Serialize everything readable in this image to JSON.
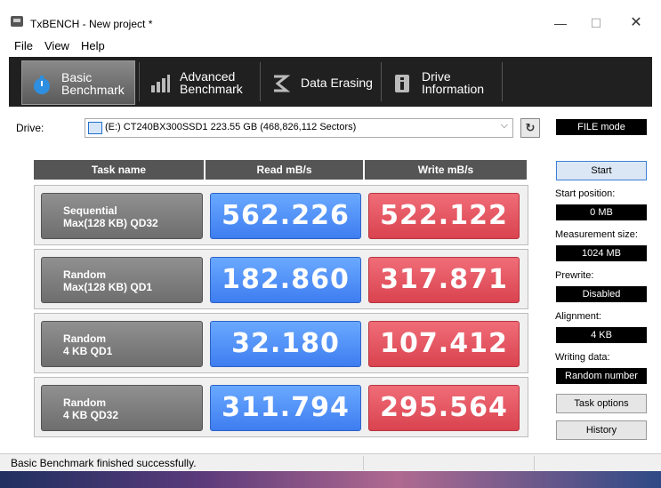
{
  "window": {
    "title": "TxBENCH - New project *",
    "min": "—",
    "max": "☐",
    "close": "✕"
  },
  "menu": [
    "File",
    "View",
    "Help"
  ],
  "tabs": [
    {
      "label1": "Basic",
      "label2": "Benchmark"
    },
    {
      "label1": "Advanced",
      "label2": "Benchmark"
    },
    {
      "label1": "Data Erasing",
      "label2": ""
    },
    {
      "label1": "Drive",
      "label2": "Information"
    }
  ],
  "drive": {
    "label": "Drive:",
    "selected": "(E:) CT240BX300SSD1  223.55 GB (468,826,112 Sectors)",
    "refresh_glyph": "↻"
  },
  "table": {
    "headers": [
      "Task name",
      "Read mB/s",
      "Write mB/s"
    ],
    "rows": [
      {
        "name1": "Sequential",
        "name2": "Max(128 KB) QD32",
        "read": "562.226",
        "write": "522.122"
      },
      {
        "name1": "Random",
        "name2": "Max(128 KB) QD1",
        "read": "182.860",
        "write": "317.871"
      },
      {
        "name1": "Random",
        "name2": "4 KB QD1",
        "read": "32.180",
        "write": "107.412"
      },
      {
        "name1": "Random",
        "name2": "4 KB QD32",
        "read": "311.794",
        "write": "295.564"
      }
    ]
  },
  "panel": {
    "mode": "FILE mode",
    "start_label": "Start",
    "start_position_label": "Start position:",
    "start_position": "0 MB",
    "measurement_size_label": "Measurement size:",
    "measurement_size": "1024 MB",
    "prewrite_label": "Prewrite:",
    "prewrite": "Disabled",
    "alignment_label": "Alignment:",
    "alignment": "4 KB",
    "writing_data_label": "Writing data:",
    "writing_data": "Random number",
    "task_options_label": "Task options",
    "history_label": "History"
  },
  "status": {
    "text": "Basic Benchmark finished successfully."
  },
  "colors": {
    "read": "#4a8cf5",
    "write": "#e24f5b",
    "toolbar": "#202020"
  }
}
